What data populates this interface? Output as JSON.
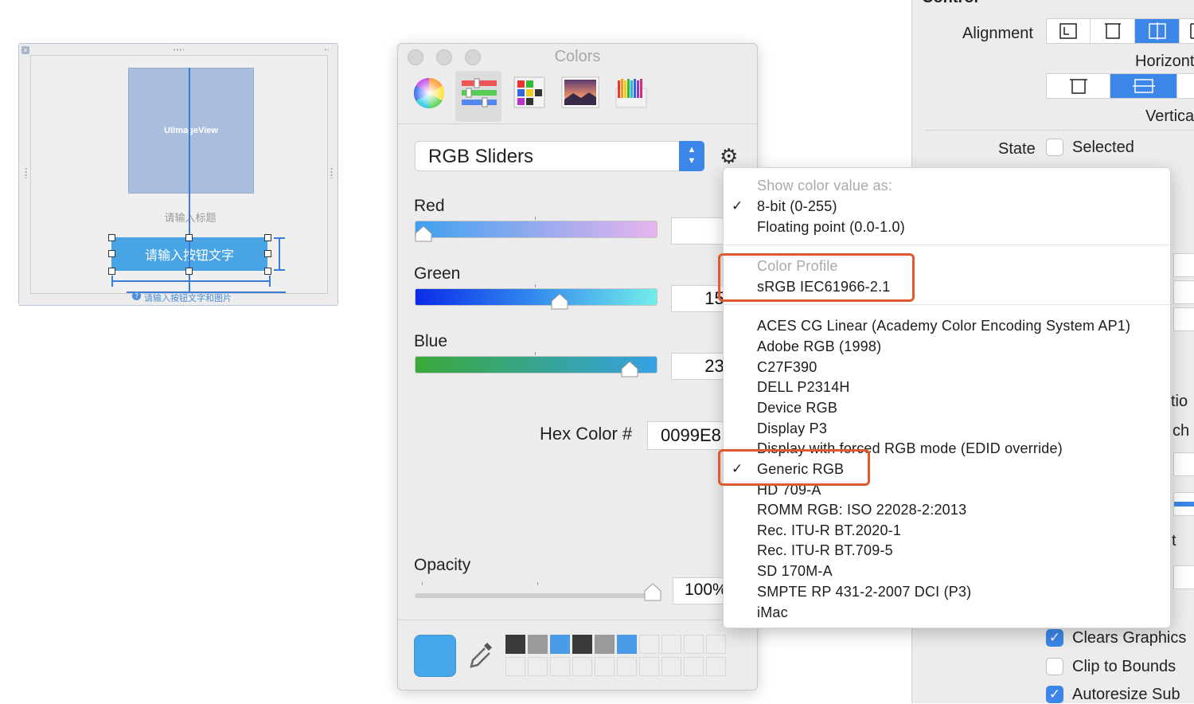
{
  "canvas": {
    "imageview_label": "UIImageView",
    "title_placeholder": "请输入标题",
    "button_placeholder": "请输入按钮文字",
    "help_text": "请输入按钮文字和图片",
    "help_icon": "?",
    "close_glyph": "×"
  },
  "colors_panel": {
    "title": "Colors",
    "modes": [
      "color-wheel-icon",
      "sliders-icon",
      "palettes-icon",
      "image-palettes-icon",
      "pencils-icon"
    ],
    "active_mode": "sliders-icon",
    "slider_mode": "RGB Sliders",
    "sliders": [
      {
        "label": "Red",
        "value": "0"
      },
      {
        "label": "Green",
        "value": "153"
      },
      {
        "label": "Blue",
        "value": "232"
      }
    ],
    "hex_label": "Hex Color #",
    "hex_value": "0099E8",
    "opacity_label": "Opacity",
    "opacity_value": "100%",
    "current_color": "#45a7ea",
    "swatches": [
      "#3a3a3a",
      "#9a9a9a",
      "#4a9ce8",
      "#3a3a3a",
      "#9a9a9a",
      "#4a9ce8"
    ]
  },
  "menu": {
    "header_show_value": "Show color value as:",
    "value_options": [
      {
        "label": "8-bit (0-255)",
        "checked": true
      },
      {
        "label": "Floating point (0.0-1.0)",
        "checked": false
      }
    ],
    "header_profile": "Color Profile",
    "current_profile": "sRGB IEC61966-2.1",
    "profiles": [
      {
        "label": "ACES CG Linear (Academy Color Encoding System AP1)",
        "checked": false
      },
      {
        "label": "Adobe RGB (1998)",
        "checked": false
      },
      {
        "label": "C27F390",
        "checked": false
      },
      {
        "label": "DELL P2314H",
        "checked": false
      },
      {
        "label": "Device RGB",
        "checked": false
      },
      {
        "label": "Display P3",
        "checked": false
      },
      {
        "label": "Display with forced RGB mode (EDID override)",
        "checked": false
      },
      {
        "label": "Generic RGB",
        "checked": true
      },
      {
        "label": "HD 709-A",
        "checked": false
      },
      {
        "label": "ROMM RGB: ISO 22028-2:2013",
        "checked": false
      },
      {
        "label": "Rec. ITU-R BT.2020-1",
        "checked": false
      },
      {
        "label": "Rec. ITU-R BT.709-5",
        "checked": false
      },
      {
        "label": "SD 170M-A",
        "checked": false
      },
      {
        "label": "SMPTE RP 431-2-2007 DCI (P3)",
        "checked": false
      },
      {
        "label": "iMac",
        "checked": false
      }
    ],
    "check_glyph": "✓",
    "highlight_color": "#e05a30"
  },
  "inspector": {
    "section_title": "Control",
    "alignment_label": "Alignment",
    "horizontal_label": "Horizontal",
    "vertical_label": "Vertical",
    "state_label": "State",
    "selected_label": "Selected",
    "partial_tion": "tio",
    "partial_ch": "ch",
    "partial_t": "t",
    "clears_graphics": "Clears Graphics",
    "clip_to_bounds": "Clip to Bounds",
    "autoresize_subviews": "Autoresize Sub",
    "accent": "#3b86e8"
  }
}
